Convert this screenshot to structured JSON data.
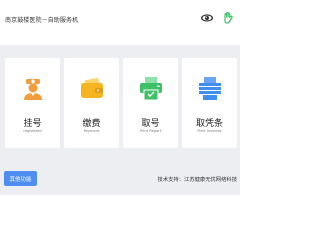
{
  "header": {
    "title": "南京鼓楼医院－自助服务机",
    "icons": [
      "eye-icon",
      "hand-icon"
    ]
  },
  "cards": [
    {
      "cn": "挂号",
      "en": "registered",
      "icon": "nurse-icon",
      "color": "#f39c3c"
    },
    {
      "cn": "缴费",
      "en": "Payment",
      "icon": "wallet-icon",
      "color": "#f5b523"
    },
    {
      "cn": "取号",
      "en": "Print Report",
      "icon": "ticket-printer-icon",
      "color": "#3fbf68"
    },
    {
      "cn": "取凭条",
      "en": "Print Invoices",
      "icon": "printer-icon",
      "color": "#3f8ef0"
    }
  ],
  "footer": {
    "other_button": "其他功能",
    "support_text": "技术支持：江苏健康无忧网络科技"
  },
  "colors": {
    "background": "#eceef2",
    "card": "#ffffff",
    "accent": "#4d8ef0"
  }
}
